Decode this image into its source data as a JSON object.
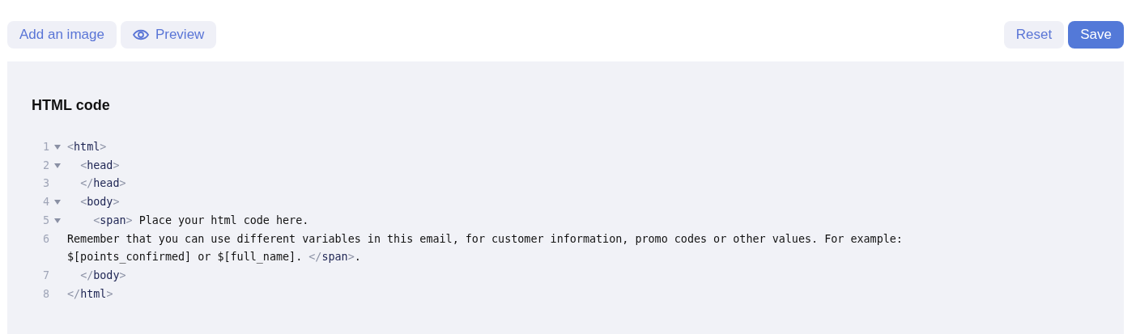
{
  "toolbar": {
    "left_buttons": [
      {
        "label": "Add an image",
        "kind": "plain"
      },
      {
        "label": "Preview",
        "kind": "eye"
      }
    ],
    "right_buttons": [
      {
        "label": "Reset",
        "kind": "secondary"
      },
      {
        "label": "Save",
        "kind": "primary"
      }
    ]
  },
  "editor": {
    "title": "HTML code",
    "lines": [
      {
        "number": "1",
        "foldable": true,
        "segments": [
          {
            "kind": "punct",
            "text": "<"
          },
          {
            "kind": "tag",
            "text": "html"
          },
          {
            "kind": "punct",
            "text": ">"
          }
        ]
      },
      {
        "number": "2",
        "foldable": true,
        "segments": [
          {
            "kind": "punct",
            "text": "  <"
          },
          {
            "kind": "tag",
            "text": "head"
          },
          {
            "kind": "punct",
            "text": ">"
          }
        ]
      },
      {
        "number": "3",
        "foldable": false,
        "segments": [
          {
            "kind": "punct",
            "text": "  </"
          },
          {
            "kind": "tag",
            "text": "head"
          },
          {
            "kind": "punct",
            "text": ">"
          }
        ]
      },
      {
        "number": "4",
        "foldable": true,
        "segments": [
          {
            "kind": "punct",
            "text": "  <"
          },
          {
            "kind": "tag",
            "text": "body"
          },
          {
            "kind": "punct",
            "text": ">"
          }
        ]
      },
      {
        "number": "5",
        "foldable": true,
        "segments": [
          {
            "kind": "punct",
            "text": "    <"
          },
          {
            "kind": "tag",
            "text": "span"
          },
          {
            "kind": "punct",
            "text": ">"
          },
          {
            "kind": "text",
            "text": " Place your html code here."
          }
        ]
      },
      {
        "number": "6",
        "foldable": false,
        "segments": [
          {
            "kind": "text",
            "text": "Remember that you can use different variables in this email, for customer information, promo codes or other values. For example: $[points_confirmed] or $[full_name]. "
          },
          {
            "kind": "punct",
            "text": "</"
          },
          {
            "kind": "tag",
            "text": "span"
          },
          {
            "kind": "punct",
            "text": ">"
          },
          {
            "kind": "text",
            "text": "."
          }
        ]
      },
      {
        "number": "7",
        "foldable": false,
        "segments": [
          {
            "kind": "punct",
            "text": "  </"
          },
          {
            "kind": "tag",
            "text": "body"
          },
          {
            "kind": "punct",
            "text": ">"
          }
        ]
      },
      {
        "number": "8",
        "foldable": false,
        "segments": [
          {
            "kind": "punct",
            "text": "</"
          },
          {
            "kind": "tag",
            "text": "html"
          },
          {
            "kind": "punct",
            "text": ">"
          }
        ]
      }
    ]
  }
}
